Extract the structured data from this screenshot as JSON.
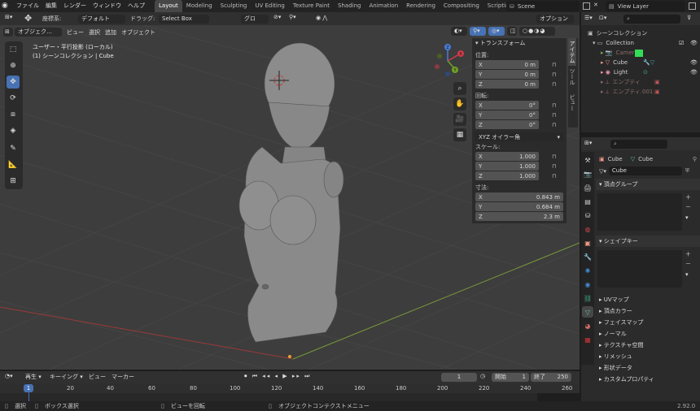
{
  "top_menu": [
    "ファイル",
    "編集",
    "レンダー",
    "ウィンドウ",
    "ヘルプ"
  ],
  "workspaces": [
    "Layout",
    "Modeling",
    "Sculpting",
    "UV Editing",
    "Texture Paint",
    "Shading",
    "Animation",
    "Rendering",
    "Compositing",
    "Scripting"
  ],
  "active_workspace": "Layout",
  "scene": "Scene",
  "view_layer": "View Layer",
  "tool_header": {
    "coord_label": "座標系:",
    "coord_value": "デフォルト",
    "drag_label": "ドラッグ:",
    "drag_value": "Select Box",
    "orientation": "グロー…",
    "options": "オプション"
  },
  "viewport_header": {
    "mode": "オブジェク…",
    "menus": [
      "ビュー",
      "選択",
      "追加",
      "オブジェクト"
    ]
  },
  "viewport_info": {
    "line1": "ユーザー・平行投影 (ローカル)",
    "line2": "(1) シーンコレクション | Cube"
  },
  "gizmo": {
    "x": "X",
    "y": "Y",
    "z": "Z"
  },
  "npanel": {
    "title": "トランスフォーム",
    "location_label": "位置:",
    "location": [
      "0 m",
      "0 m",
      "0 m"
    ],
    "rotation_label": "回転:",
    "rotation": [
      "0°",
      "0°",
      "0°"
    ],
    "rotation_mode": "XYZ オイラー角",
    "scale_label": "スケール:",
    "scale": [
      "1.000",
      "1.000",
      "1.000"
    ],
    "dims_label": "寸法:",
    "dims": [
      "0.843 m",
      "0.684 m",
      "2.3 m"
    ],
    "axes": [
      "X",
      "Y",
      "Z"
    ],
    "tabs": [
      "アイテム",
      "ツール",
      "ビュー"
    ]
  },
  "outliner": {
    "root": "シーンコレクション",
    "collection": "Collection",
    "items": [
      "Camera",
      "Cube",
      "Light",
      "エンプティ",
      "エンプティ.001"
    ]
  },
  "properties": {
    "object_name": "Cube",
    "data_name": "Cube",
    "mesh_name": "Cube",
    "vertex_groups": "頂点グループ",
    "shape_keys": "シェイプキー",
    "collapsed": [
      "UVマップ",
      "頂点カラー",
      "フェイスマップ",
      "ノーマル",
      "テクスチャ空間",
      "リメッシュ",
      "形状データ",
      "カスタムプロパティ"
    ]
  },
  "timeline": {
    "menus": [
      "再生",
      "キーイング",
      "ビュー",
      "マーカー"
    ],
    "current_frame": "1",
    "start_label": "開始",
    "start": "1",
    "end_label": "終了",
    "end": "250",
    "ticks": [
      "1",
      "20",
      "40",
      "60",
      "80",
      "100",
      "120",
      "140",
      "160",
      "180",
      "200",
      "220",
      "240",
      "260"
    ]
  },
  "statusbar": {
    "select": "選択",
    "box_select": "ボックス選択",
    "rotate": "ビューを回転",
    "context": "オブジェクトコンテクストメニュー",
    "version": "2.92.0"
  },
  "colors": {
    "accent": "#4772b3",
    "grid_x": "#9a3a3a",
    "grid_y": "#7a9a3a",
    "bg": "#3d3d3d"
  }
}
